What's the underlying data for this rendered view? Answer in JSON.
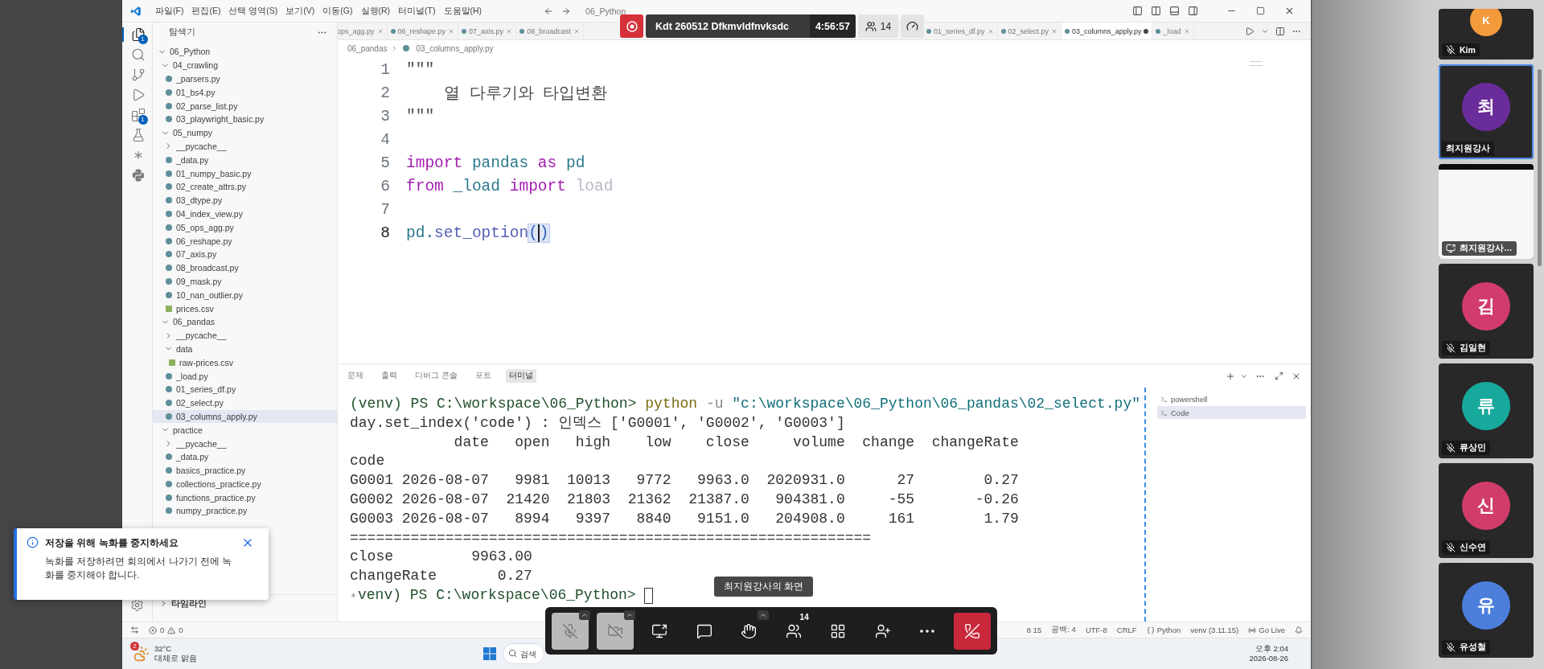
{
  "meeting": {
    "title": "Kdt 260512 Dfkmvldfnvksdc",
    "elapsed": "4:56:57",
    "participant_count": "14",
    "share_label": "최지원강사의 화면"
  },
  "vscode": {
    "title": "06_Python",
    "menus": [
      "파일(F)",
      "편집(E)",
      "선택 영역(S)",
      "보기(V)",
      "이동(G)",
      "실행(R)",
      "터미널(T)",
      "도움말(H)"
    ],
    "activity": [
      {
        "kind": "explorer",
        "badge": "1",
        "selected": true
      },
      {
        "kind": "search",
        "selected": false
      },
      {
        "kind": "source-control",
        "selected": false
      },
      {
        "kind": "run",
        "selected": false
      },
      {
        "kind": "extensions",
        "badge": "1",
        "selected": false
      },
      {
        "kind": "testing",
        "selected": false
      },
      {
        "kind": "spark",
        "selected": false
      },
      {
        "kind": "python",
        "selected": false
      }
    ],
    "sidebar": {
      "title": "탐색기",
      "timeline": "타임라인",
      "tree": [
        {
          "name": "06_Python",
          "kind": "folder",
          "expanded": true,
          "selected": false,
          "children": [
            {
              "name": "04_crawling",
              "kind": "folder",
              "expanded": true,
              "selected": false,
              "children": [
                {
                  "name": "_parsers.py",
                  "kind": "py",
                  "selected": false
                },
                {
                  "name": "01_bs4.py",
                  "kind": "py",
                  "selected": false
                },
                {
                  "name": "02_parse_list.py",
                  "kind": "py",
                  "selected": false
                },
                {
                  "name": "03_playwright_basic.py",
                  "kind": "py",
                  "selected": false
                }
              ]
            },
            {
              "name": "05_numpy",
              "kind": "folder",
              "expanded": true,
              "selected": false,
              "children": [
                {
                  "name": "__pycache__",
                  "kind": "folder",
                  "expanded": false,
                  "selected": false
                },
                {
                  "name": "_data.py",
                  "kind": "py",
                  "selected": false
                },
                {
                  "name": "01_numpy_basic.py",
                  "kind": "py",
                  "selected": false
                },
                {
                  "name": "02_create_attrs.py",
                  "kind": "py",
                  "selected": false
                },
                {
                  "name": "03_dtype.py",
                  "kind": "py",
                  "selected": false
                },
                {
                  "name": "04_index_view.py",
                  "kind": "py",
                  "selected": false
                },
                {
                  "name": "05_ops_agg.py",
                  "kind": "py",
                  "selected": false
                },
                {
                  "name": "06_reshape.py",
                  "kind": "py",
                  "selected": false
                },
                {
                  "name": "07_axis.py",
                  "kind": "py",
                  "selected": false
                },
                {
                  "name": "08_broadcast.py",
                  "kind": "py",
                  "selected": false
                },
                {
                  "name": "09_mask.py",
                  "kind": "py",
                  "selected": false
                },
                {
                  "name": "10_nan_outlier.py",
                  "kind": "py",
                  "selected": false
                },
                {
                  "name": "prices.csv",
                  "kind": "csv",
                  "selected": false
                }
              ]
            },
            {
              "name": "06_pandas",
              "kind": "folder",
              "expanded": true,
              "selected": false,
              "children": [
                {
                  "name": "__pycache__",
                  "kind": "folder",
                  "expanded": false,
                  "selected": false
                },
                {
                  "name": "data",
                  "kind": "folder",
                  "expanded": true,
                  "selected": false,
                  "children": [
                    {
                      "name": "raw-prices.csv",
                      "kind": "csv",
                      "selected": false
                    }
                  ]
                },
                {
                  "name": "_load.py",
                  "kind": "py",
                  "selected": false
                },
                {
                  "name": "01_series_df.py",
                  "kind": "py",
                  "selected": false
                },
                {
                  "name": "02_select.py",
                  "kind": "py",
                  "selected": false
                },
                {
                  "name": "03_columns_apply.py",
                  "kind": "py",
                  "selected": true
                }
              ]
            },
            {
              "name": "practice",
              "kind": "folder",
              "expanded": true,
              "selected": false,
              "children": [
                {
                  "name": "__pycache__",
                  "kind": "folder",
                  "expanded": false,
                  "selected": false
                },
                {
                  "name": "_data.py",
                  "kind": "py",
                  "selected": false
                },
                {
                  "name": "basics_practice.py",
                  "kind": "py",
                  "selected": false
                },
                {
                  "name": "collections_practice.py",
                  "kind": "py",
                  "selected": false
                },
                {
                  "name": "functions_practice.py",
                  "kind": "py",
                  "selected": false
                },
                {
                  "name": "numpy_practice.py",
                  "kind": "py",
                  "selected": false
                }
              ]
            }
          ]
        }
      ]
    },
    "tabs": [
      {
        "label": "ops_agg.py",
        "selected": false,
        "modified": false
      },
      {
        "label": "06_reshape.py",
        "selected": false,
        "modified": false
      },
      {
        "label": "07_axis.py",
        "selected": false,
        "modified": false
      },
      {
        "label": "08_broadcast",
        "selected": false,
        "modified": false
      },
      {
        "label": "01_series_df.py",
        "selected": false,
        "modified": false
      },
      {
        "label": "02_select.py",
        "selected": false,
        "modified": false
      },
      {
        "label": "03_columns_apply.py",
        "selected": true,
        "modified": true
      },
      {
        "label": "_load",
        "selected": false,
        "modified": false
      }
    ],
    "breadcrumb": [
      "06_pandas",
      "03_columns_apply.py"
    ],
    "code": [
      {
        "number": "1",
        "active": false,
        "tokens": [
          {
            "kind": "string",
            "text": "\"\"\""
          }
        ]
      },
      {
        "number": "2",
        "active": false,
        "tokens": [
          {
            "kind": "string",
            "text": "    열 다루기와 타입변환"
          }
        ]
      },
      {
        "number": "3",
        "active": false,
        "tokens": [
          {
            "kind": "string",
            "text": "\"\"\""
          }
        ]
      },
      {
        "number": "4",
        "active": false
      },
      {
        "number": "5",
        "active": false,
        "tokens": [
          {
            "kind": "keyword",
            "text": "import "
          },
          {
            "kind": "module",
            "text": "pandas "
          },
          {
            "kind": "keyword",
            "text": "as "
          },
          {
            "kind": "module",
            "text": "pd"
          }
        ]
      },
      {
        "number": "6",
        "active": false,
        "tokens": [
          {
            "kind": "keyword",
            "text": "from "
          },
          {
            "kind": "module",
            "text": "_load "
          },
          {
            "kind": "keyword",
            "text": "import "
          },
          {
            "kind": "faded",
            "text": "load"
          }
        ]
      },
      {
        "number": "7",
        "active": false
      },
      {
        "number": "8",
        "active": true,
        "tokens": [
          {
            "kind": "module",
            "text": "pd."
          },
          {
            "kind": "function",
            "text": "set_option"
          },
          {
            "kind": "bracket",
            "text": "()"
          }
        ]
      }
    ],
    "panel": {
      "tabs": [
        {
          "label": "문제",
          "selected": false
        },
        {
          "label": "출력",
          "selected": false
        },
        {
          "label": "디버그 콘솔",
          "selected": false
        },
        {
          "label": "포트",
          "selected": false
        },
        {
          "label": "터미널",
          "selected": true
        }
      ],
      "terminal": [
        {
          "kind": "command",
          "prompt": "(venv) PS C:\\workspace\\06_Python> ",
          "program": "python",
          "flag": " -u ",
          "path": "\"c:\\workspace\\06_Python\\06_pandas\\02_select.py\""
        },
        {
          "kind": "output",
          "text": "day.set_index('code') : 인덱스 ['G0001', 'G0002', 'G0003']"
        },
        {
          "kind": "output",
          "text": "            date   open   high    low    close     volume  change  changeRate"
        },
        {
          "kind": "output",
          "text": "code"
        },
        {
          "kind": "output",
          "text": "G0001 2026-08-07   9981  10013   9772   9963.0  2020931.0      27        0.27"
        },
        {
          "kind": "output",
          "text": "G0002 2026-08-07  21420  21803  21362  21387.0   904381.0     -55       -0.26"
        },
        {
          "kind": "output",
          "text": "G0003 2026-08-07   8994   9397   8840   9151.0   204908.0     161        1.79"
        },
        {
          "kind": "output",
          "text": "============================================================"
        },
        {
          "kind": "output",
          "text": "close         9963.00"
        },
        {
          "kind": "output",
          "text": "changeRate       0.27"
        },
        {
          "kind": "prompt",
          "prompt": "venv) PS C:\\workspace\\06_Python> "
        }
      ],
      "sessions": [
        {
          "label": "powershell",
          "selected": false
        },
        {
          "label": "Code",
          "selected": true
        }
      ]
    },
    "status": {
      "errors": "0",
      "warnings": "0",
      "items": [
        {
          "kind": "plain",
          "text": "8 15"
        },
        {
          "kind": "plain",
          "text": "공백: 4"
        },
        {
          "kind": "plain",
          "text": "UTF-8"
        },
        {
          "kind": "plain",
          "text": "CRLF"
        },
        {
          "kind": "language",
          "text": "Python"
        },
        {
          "kind": "plain",
          "text": "venv (3.11.15)"
        },
        {
          "kind": "live",
          "text": "Go Live"
        }
      ]
    }
  },
  "taskbar": {
    "temperature": "32°C",
    "weather": "대체로 맑음",
    "weather_badge": "2",
    "search": {
      "placeholder": "검색"
    },
    "time": "오후 2:04",
    "date": "2026-08-26"
  },
  "notification": {
    "title": "저장을 위해 녹화를 중지하세요",
    "body": "녹화를 저장하려면 회의에서 나가기 전에 녹화를 중지해야 합니다."
  },
  "toolbar": [
    {
      "kind": "microphone",
      "disabled": true
    },
    {
      "kind": "camera",
      "disabled": true
    },
    {
      "kind": "share",
      "disabled": false
    },
    {
      "kind": "chat",
      "disabled": false
    },
    {
      "kind": "raise-hand",
      "disabled": false
    },
    {
      "kind": "participants",
      "disabled": false,
      "badge": "14"
    },
    {
      "kind": "tile-view",
      "disabled": false
    },
    {
      "kind": "invite",
      "disabled": false
    },
    {
      "kind": "more",
      "disabled": false
    },
    {
      "kind": "leave",
      "disabled": false
    }
  ],
  "filmstrip": [
    {
      "kind": "camera",
      "initial": "K",
      "name": "Kim",
      "muted": true,
      "selected": false,
      "color": "#f39a3c"
    },
    {
      "kind": "camera",
      "initial": "최",
      "name": "최지원강사",
      "muted": false,
      "selected": true,
      "color": "#6a2c9a"
    },
    {
      "kind": "screen",
      "name": "최지원강사…",
      "selected": false
    },
    {
      "kind": "camera",
      "initial": "김",
      "name": "김일현",
      "muted": true,
      "selected": false,
      "color": "#d23c6c"
    },
    {
      "kind": "camera",
      "initial": "류",
      "name": "류상민",
      "muted": true,
      "selected": false,
      "color": "#17a99b"
    },
    {
      "kind": "camera",
      "initial": "신",
      "name": "신수연",
      "muted": true,
      "selected": false,
      "color": "#d13d6b"
    },
    {
      "kind": "camera",
      "initial": "유",
      "name": "유성철",
      "muted": true,
      "selected": false,
      "color": "#4c7fdc"
    }
  ]
}
